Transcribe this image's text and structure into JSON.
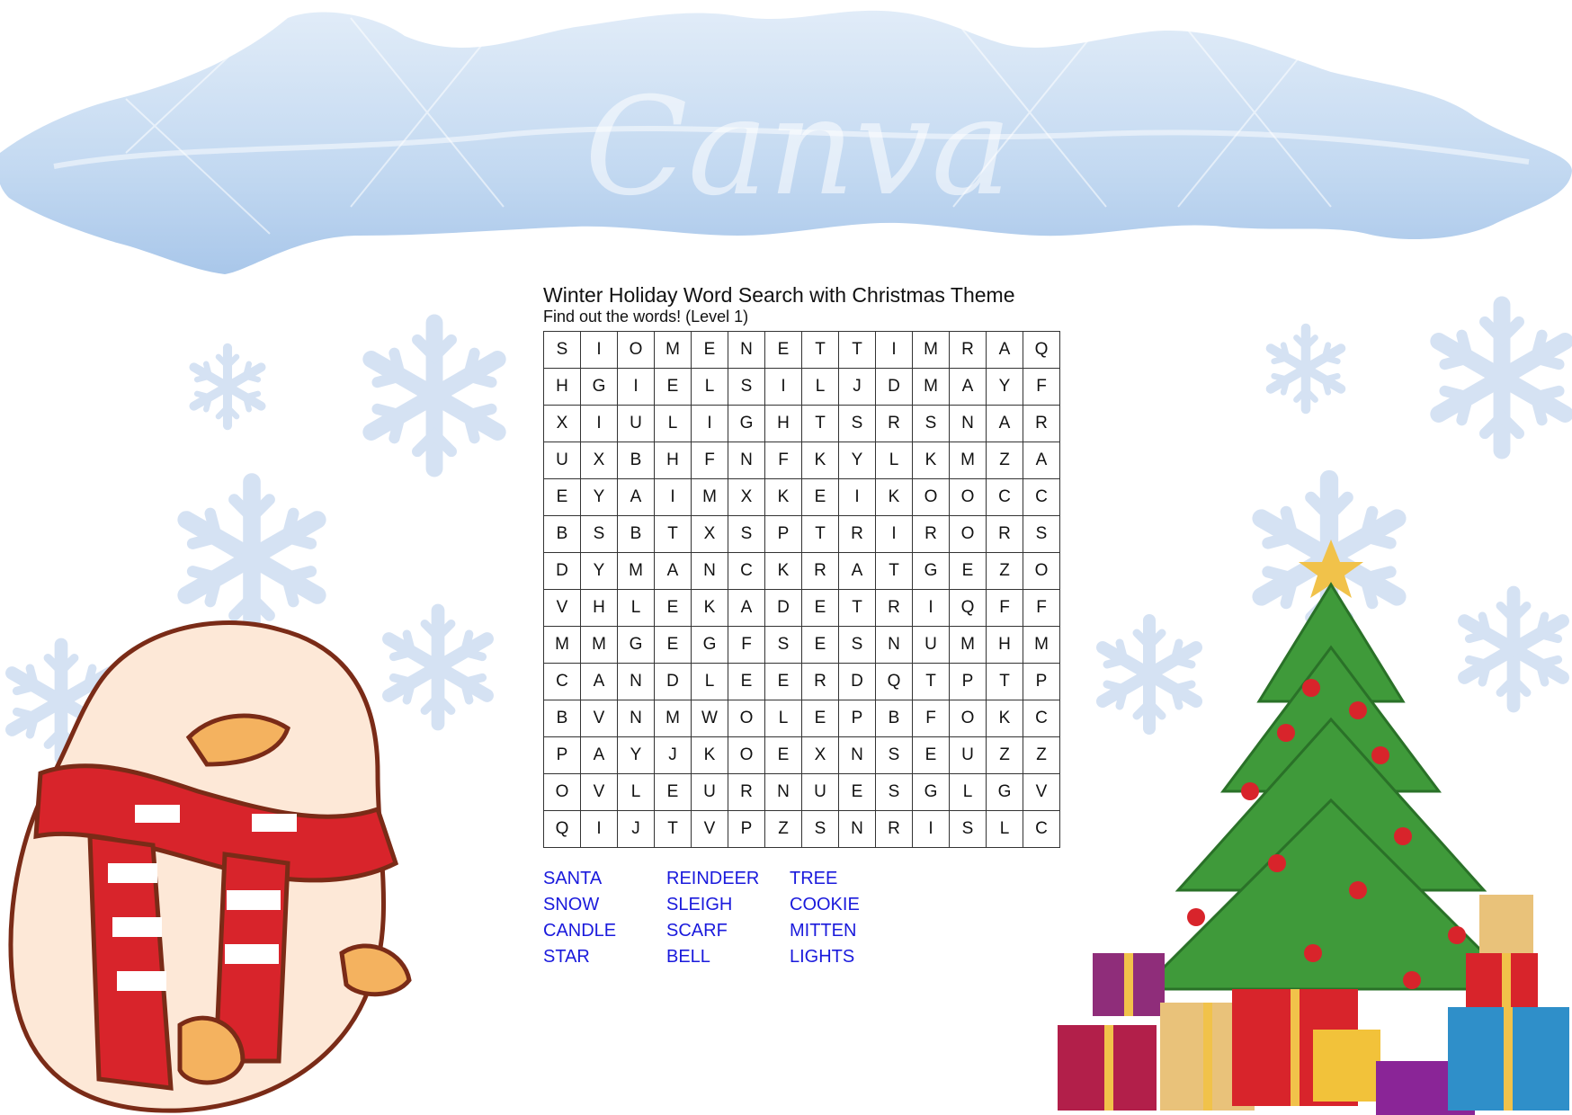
{
  "worksheet": {
    "title": "Winter Holiday Word Search with Christmas Theme",
    "subtitle": "Find out the words! (Level 1)",
    "grid": [
      [
        "S",
        "I",
        "O",
        "M",
        "E",
        "N",
        "E",
        "T",
        "T",
        "I",
        "M",
        "R",
        "A",
        "Q"
      ],
      [
        "H",
        "G",
        "I",
        "E",
        "L",
        "S",
        "I",
        "L",
        "J",
        "D",
        "M",
        "A",
        "Y",
        "F"
      ],
      [
        "X",
        "I",
        "U",
        "L",
        "I",
        "G",
        "H",
        "T",
        "S",
        "R",
        "S",
        "N",
        "A",
        "R"
      ],
      [
        "U",
        "X",
        "B",
        "H",
        "F",
        "N",
        "F",
        "K",
        "Y",
        "L",
        "K",
        "M",
        "Z",
        "A"
      ],
      [
        "E",
        "Y",
        "A",
        "I",
        "M",
        "X",
        "K",
        "E",
        "I",
        "K",
        "O",
        "O",
        "C",
        "C"
      ],
      [
        "B",
        "S",
        "B",
        "T",
        "X",
        "S",
        "P",
        "T",
        "R",
        "I",
        "R",
        "O",
        "R",
        "S"
      ],
      [
        "D",
        "Y",
        "M",
        "A",
        "N",
        "C",
        "K",
        "R",
        "A",
        "T",
        "G",
        "E",
        "Z",
        "O"
      ],
      [
        "V",
        "H",
        "L",
        "E",
        "K",
        "A",
        "D",
        "E",
        "T",
        "R",
        "I",
        "Q",
        "F",
        "F"
      ],
      [
        "M",
        "M",
        "G",
        "E",
        "G",
        "F",
        "S",
        "E",
        "S",
        "N",
        "U",
        "M",
        "H",
        "M"
      ],
      [
        "C",
        "A",
        "N",
        "D",
        "L",
        "E",
        "E",
        "R",
        "D",
        "Q",
        "T",
        "P",
        "T",
        "P"
      ],
      [
        "B",
        "V",
        "N",
        "M",
        "W",
        "O",
        "L",
        "E",
        "P",
        "B",
        "F",
        "O",
        "K",
        "C"
      ],
      [
        "P",
        "A",
        "Y",
        "J",
        "K",
        "O",
        "E",
        "X",
        "N",
        "S",
        "E",
        "U",
        "Z",
        "Z"
      ],
      [
        "O",
        "V",
        "L",
        "E",
        "U",
        "R",
        "N",
        "U",
        "E",
        "S",
        "G",
        "L",
        "G",
        "V"
      ],
      [
        "Q",
        "I",
        "J",
        "T",
        "V",
        "P",
        "Z",
        "S",
        "N",
        "R",
        "I",
        "S",
        "L",
        "C"
      ]
    ],
    "words": [
      "SANTA",
      "SNOW",
      "CANDLE",
      "STAR",
      "REINDEER",
      "SLEIGH",
      "SCARF",
      "BELL",
      "TREE",
      "COOKIE",
      "MITTEN",
      "LIGHTS"
    ],
    "word_color": "#1a1adc"
  },
  "decor": {
    "watermark": "Canva",
    "icons": [
      "snow-cloud-banner",
      "snowflake-icon",
      "duck-in-scarf-illustration",
      "christmas-tree-illustration",
      "gift-boxes-illustration"
    ],
    "colors": {
      "snow_blue": "#c5dcf2",
      "snowflake": "#dbe6f4",
      "scarf_red": "#d8242b",
      "tree_green": "#3f9a3a"
    }
  }
}
